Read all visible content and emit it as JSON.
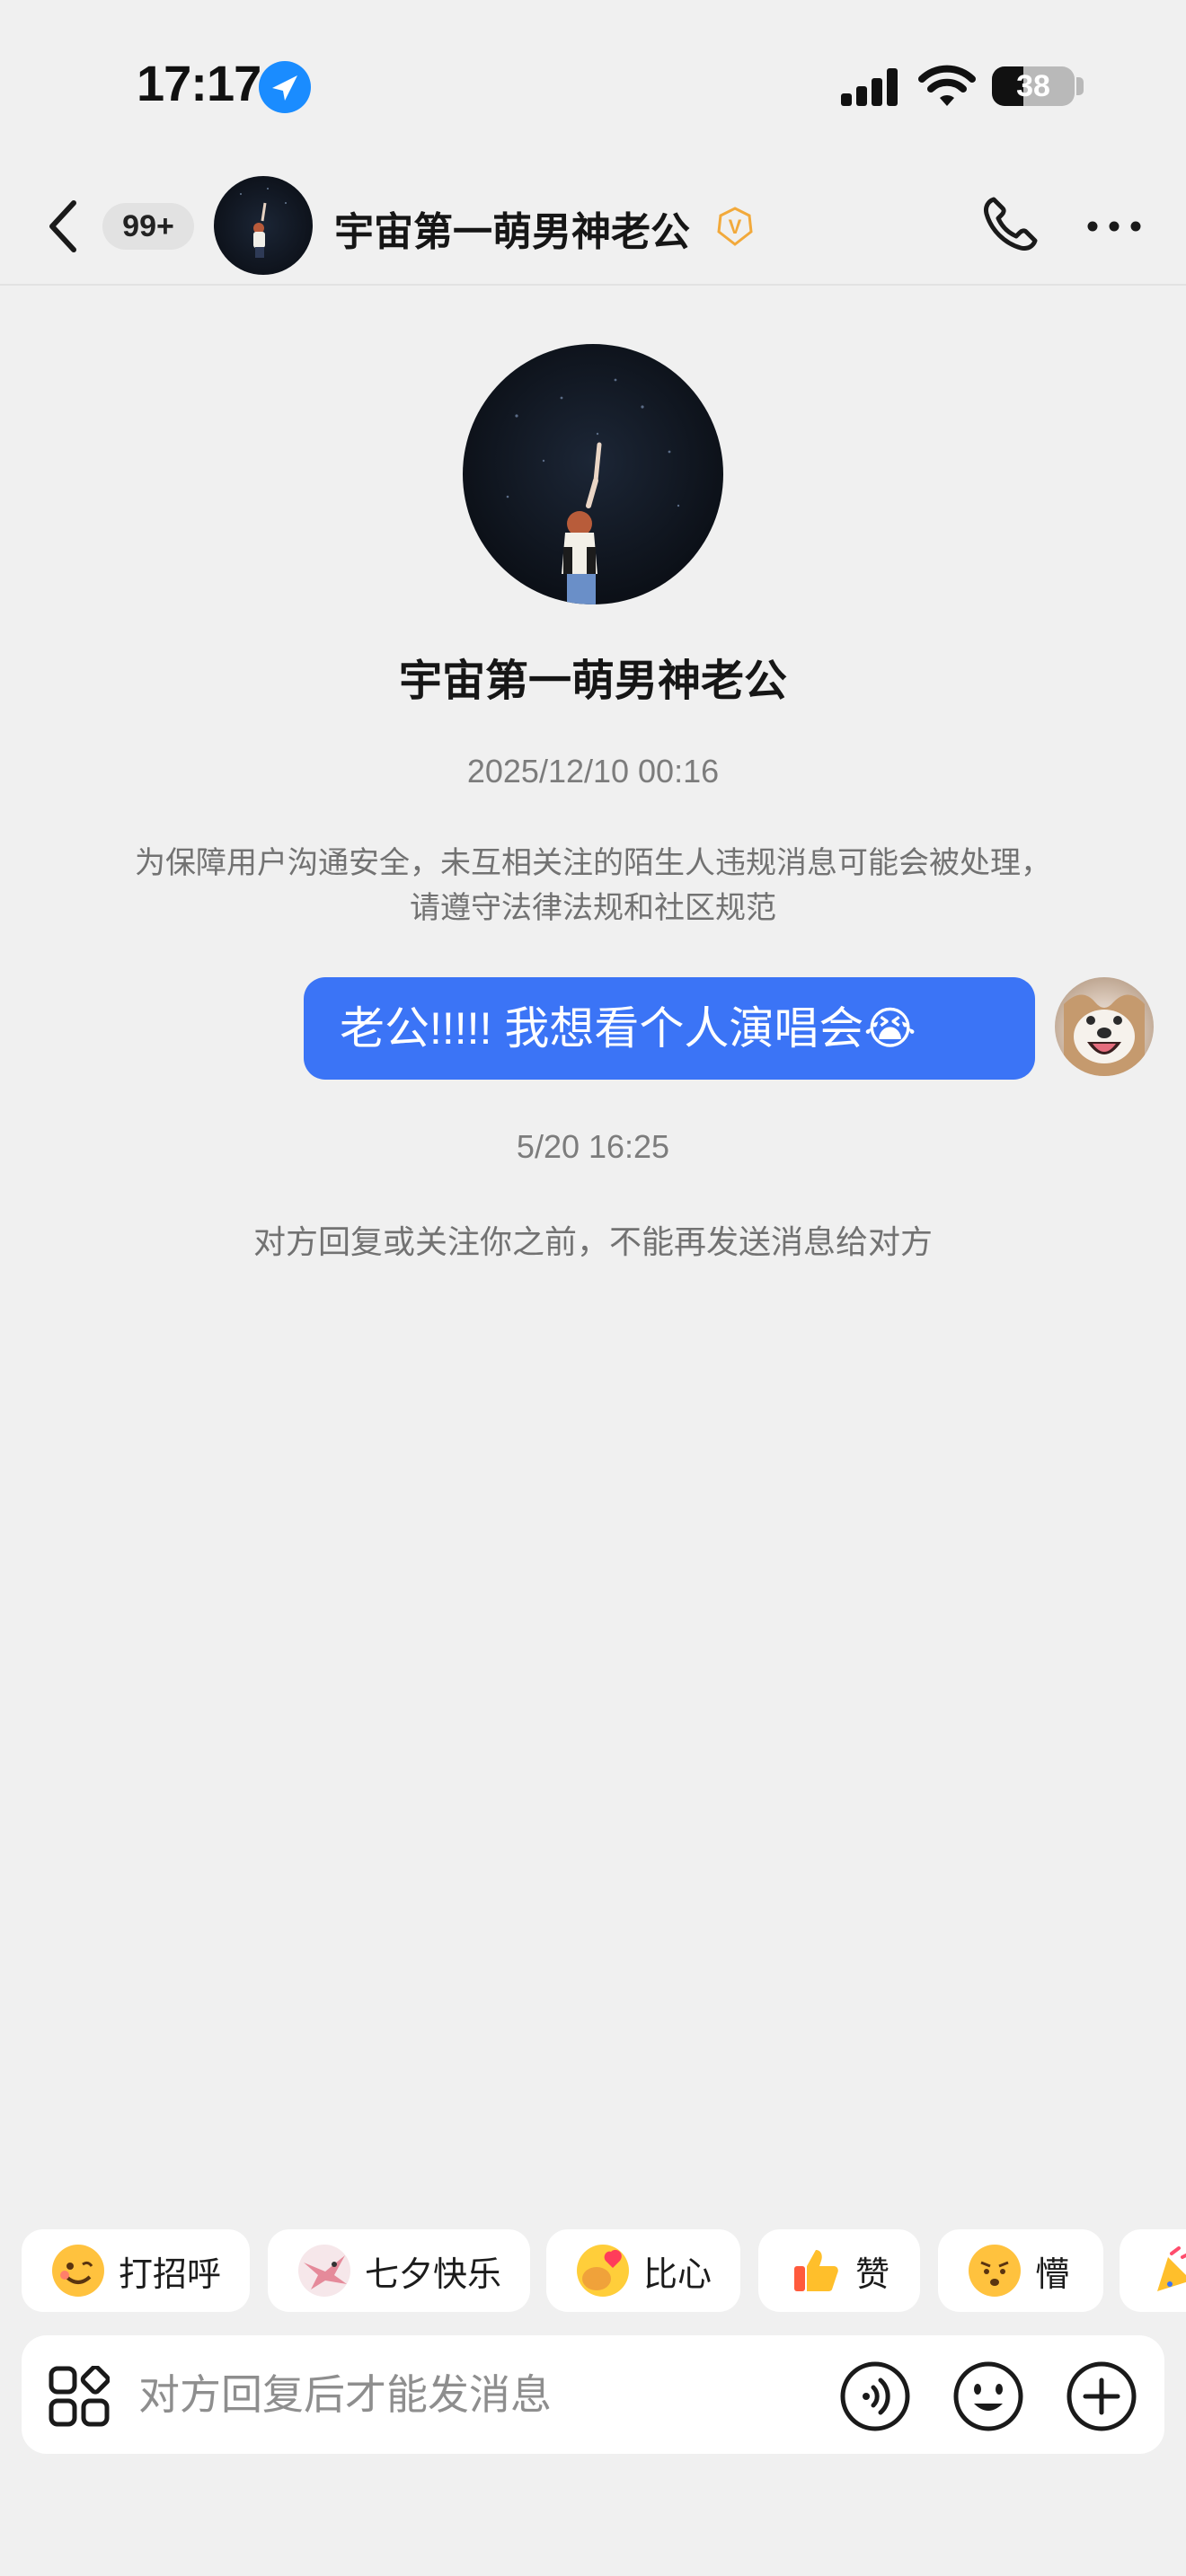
{
  "status_bar": {
    "time": "17:17",
    "battery_level": "38",
    "icons": [
      "location-arrow-icon",
      "cellular-signal-icon",
      "wifi-icon",
      "battery-icon"
    ]
  },
  "header": {
    "unread_count": "99+",
    "title": "宇宙第一萌男神老公",
    "verified_mark": "V",
    "icons": [
      "back-arrow-icon",
      "verified-badge-icon",
      "phone-icon",
      "more-icon"
    ]
  },
  "profile": {
    "name": "宇宙第一萌男神老公"
  },
  "conversation": {
    "first_time": "2025/12/10 00:16",
    "safety_notice": "为保障用户沟通安全，未互相关注的陌生人违规消息可能会被处理，请遵守法律法规和社区规范",
    "messages": [
      {
        "text": "老公!!!!! 我想看个人演唱会😭",
        "from": "me"
      }
    ],
    "second_time": "5/20 16:25",
    "limit_notice": "对方回复或关注你之前，不能再发送消息给对方"
  },
  "quick_replies": [
    {
      "label": "打招呼",
      "icon": "smile-face-icon"
    },
    {
      "label": "七夕快乐",
      "icon": "magpie-icon"
    },
    {
      "label": "比心",
      "icon": "finger-heart-icon"
    },
    {
      "label": "赞",
      "icon": "thumbs-up-icon"
    },
    {
      "label": "懵",
      "icon": "confused-face-icon"
    }
  ],
  "input": {
    "placeholder": "对方回复后才能发消息",
    "value": "",
    "icons": [
      "apps-icon",
      "voice-icon",
      "emoji-icon",
      "plus-icon"
    ]
  },
  "colors": {
    "background": "#f0f0f0",
    "bubble": "#3b74f6",
    "location": "#1a8cff",
    "verified": "#f2a93b"
  }
}
